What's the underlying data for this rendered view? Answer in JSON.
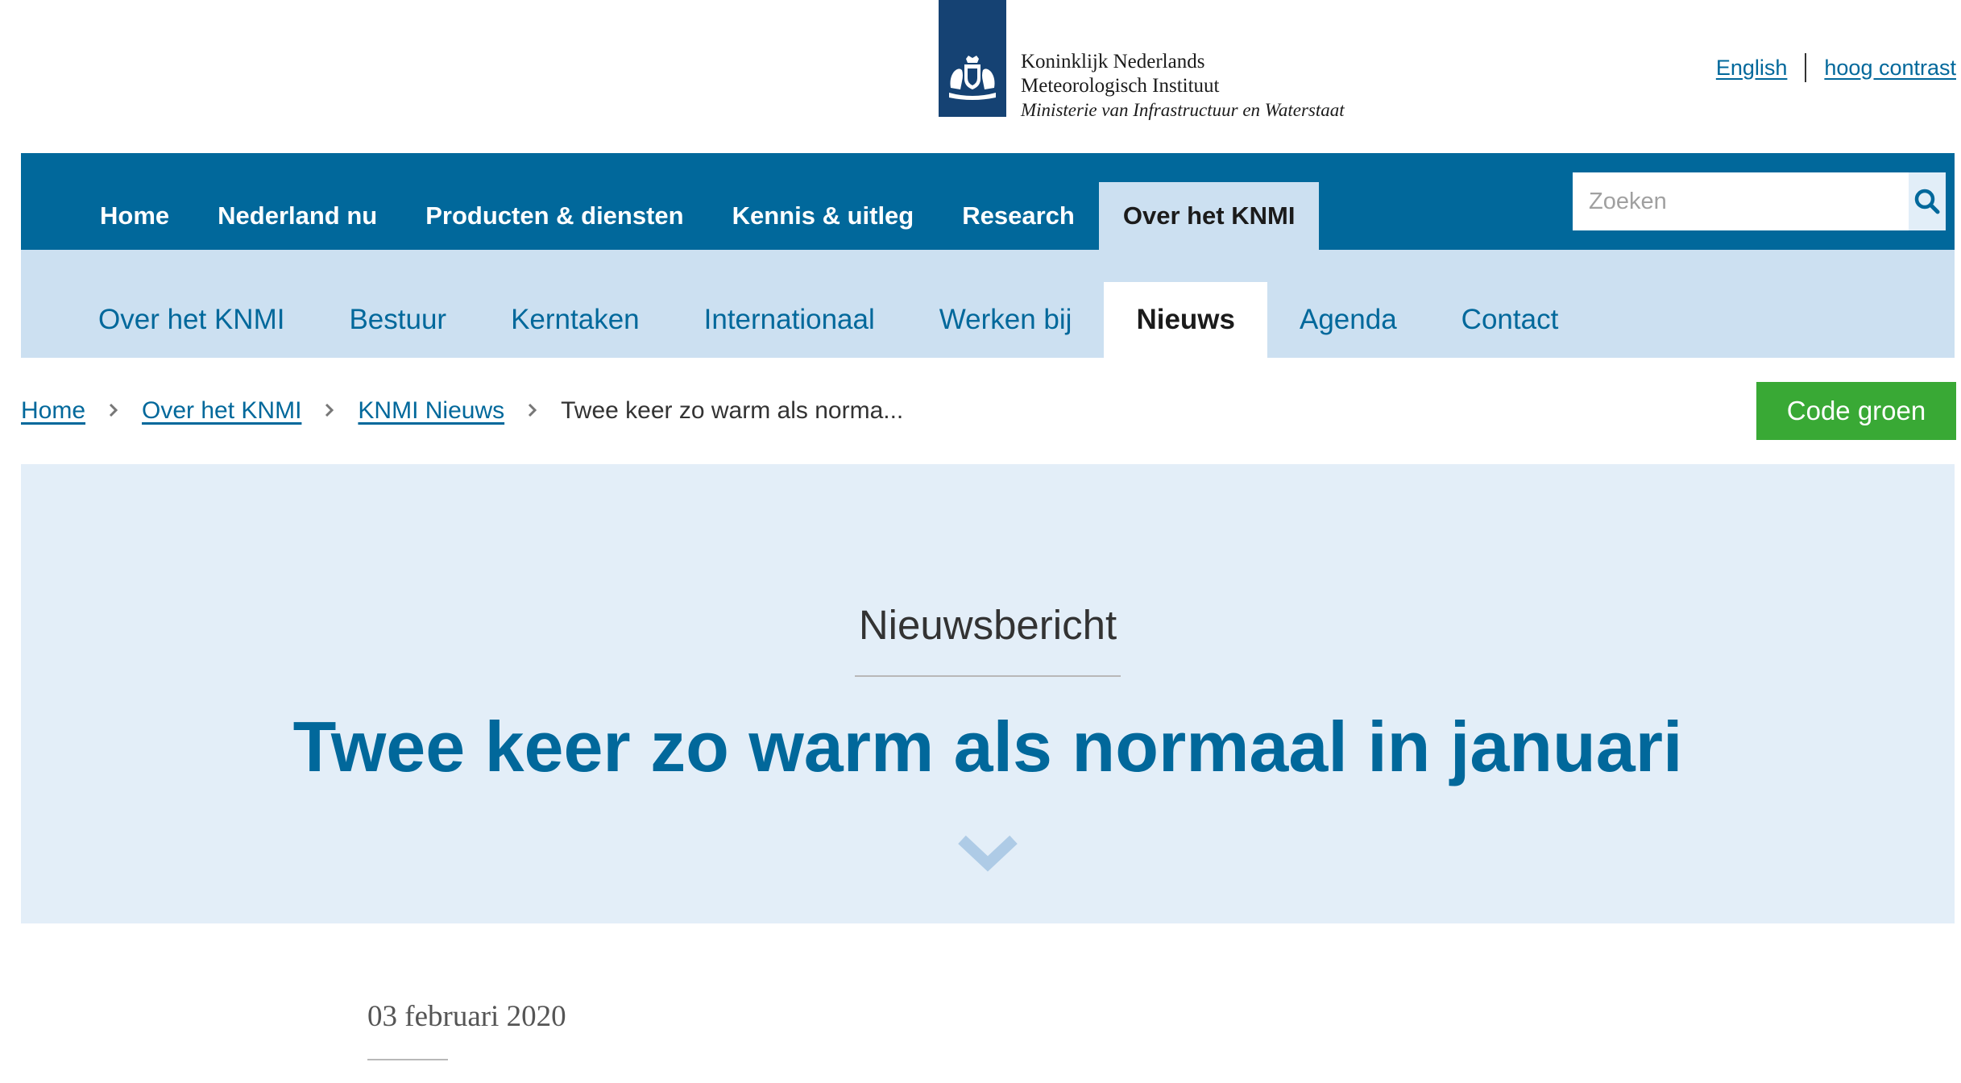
{
  "header": {
    "logo": {
      "line1": "Koninklijk Nederlands",
      "line2": "Meteorologisch Instituut",
      "line3": "Ministerie van Infrastructuur en Waterstaat",
      "icon": "coat-of-arms-icon"
    },
    "utility": {
      "english_label": "English",
      "contrast_label": "hoog contrast"
    }
  },
  "primary_nav": {
    "items": [
      {
        "label": "Home"
      },
      {
        "label": "Nederland nu"
      },
      {
        "label": "Producten & diensten"
      },
      {
        "label": "Kennis & uitleg"
      },
      {
        "label": "Research"
      },
      {
        "label": "Over het KNMI",
        "active": true
      }
    ],
    "search": {
      "placeholder": "Zoeken",
      "icon": "search-icon"
    }
  },
  "secondary_nav": {
    "items": [
      {
        "label": "Over het KNMI"
      },
      {
        "label": "Bestuur"
      },
      {
        "label": "Kerntaken"
      },
      {
        "label": "Internationaal"
      },
      {
        "label": "Werken bij"
      },
      {
        "label": "Nieuws",
        "active": true
      },
      {
        "label": "Agenda"
      },
      {
        "label": "Contact"
      }
    ]
  },
  "breadcrumb": {
    "items": [
      "Home",
      "Over het KNMI",
      "KNMI Nieuws"
    ],
    "current": "Twee keer zo warm als norma...",
    "separator": "›"
  },
  "code_button": {
    "label": "Code groen",
    "color": "#39a935"
  },
  "hero": {
    "label": "Nieuwsbericht",
    "title": "Twee keer zo warm als normaal in januari",
    "scroll_icon": "chevron-down-icon"
  },
  "article": {
    "date": "03 februari 2020"
  },
  "colors": {
    "primary": "#01689b",
    "light_blue": "#cce0f1",
    "hero_bg": "#e3eef8",
    "logo_bg": "#154273"
  }
}
